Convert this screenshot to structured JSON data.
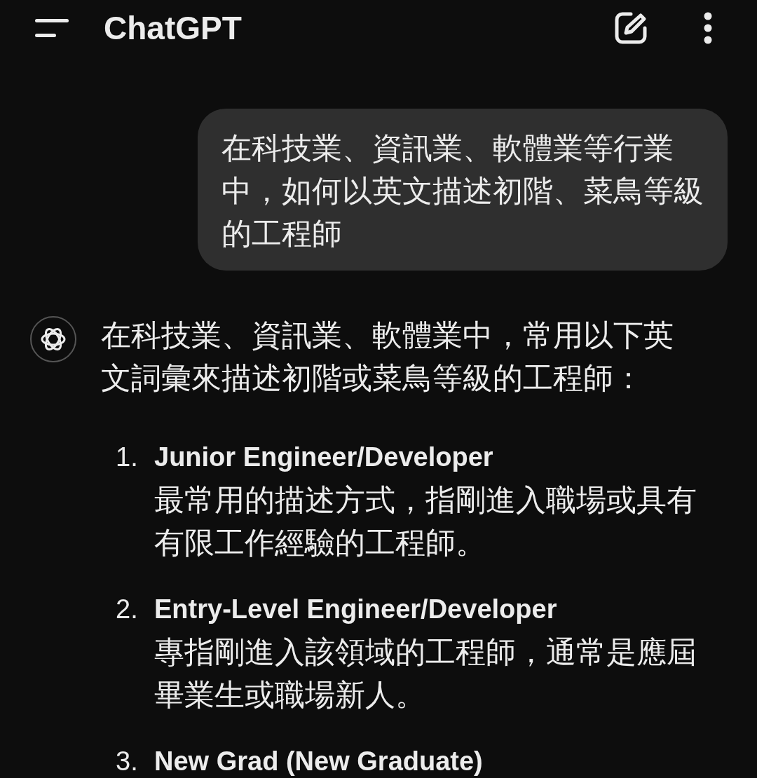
{
  "header": {
    "title": "ChatGPT"
  },
  "messages": [
    {
      "kind": "user",
      "text": "在科技業、資訊業、軟體業等行業中，如何以英文描述初階、菜鳥等級的工程師"
    },
    {
      "kind": "assistant",
      "text": "在科技業、資訊業、軟體業中，常用以下英文詞彙來描述初階或菜鳥等級的工程師：",
      "list": [
        {
          "number": "1.",
          "title": "Junior Engineer/Developer",
          "description": "最常用的描述方式，指剛進入職場或具有有限工作經驗的工程師。"
        },
        {
          "number": "2.",
          "title": "Entry-Level Engineer/Developer",
          "description": "專指剛進入該領域的工程師，通常是應屆畢業生或職場新人。"
        },
        {
          "number": "3.",
          "title": "New Grad (New Graduate)"
        }
      ]
    }
  ]
}
